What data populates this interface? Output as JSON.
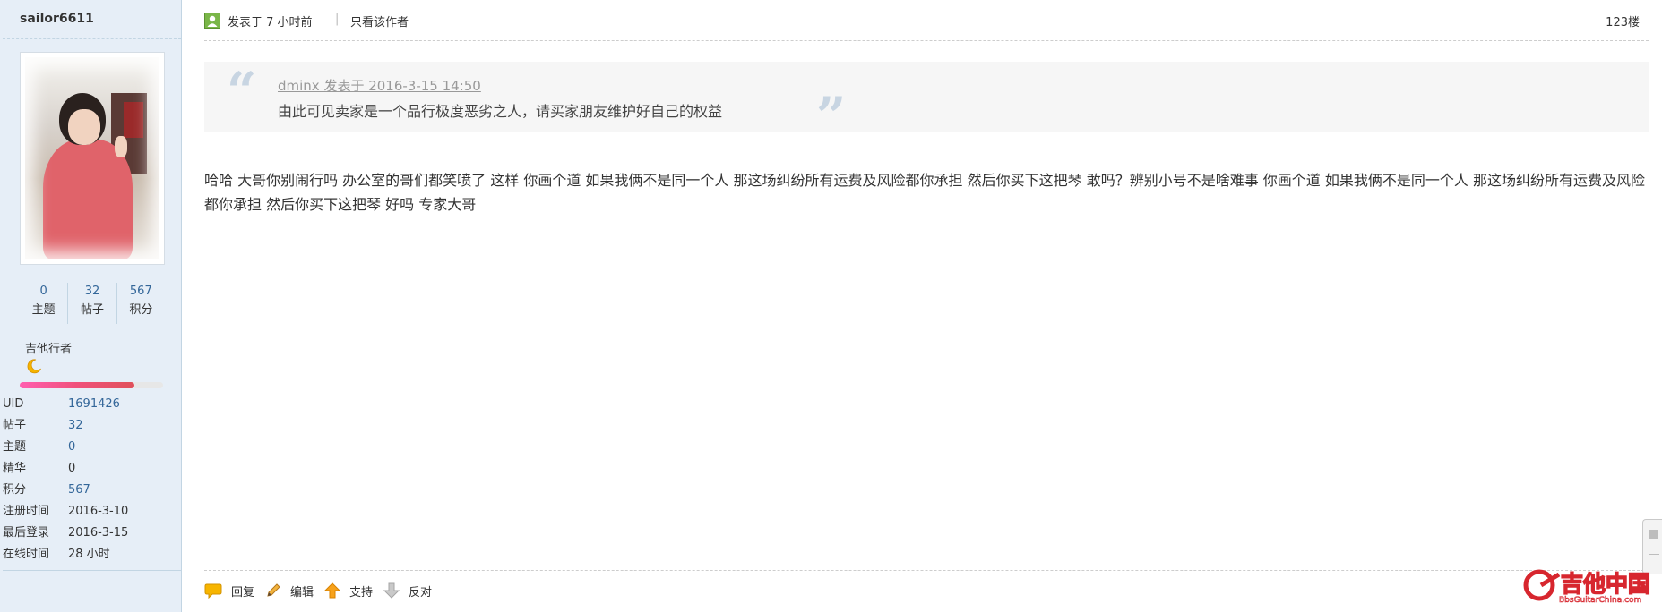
{
  "user": {
    "username": "sailor6611",
    "stats": [
      {
        "value": "0",
        "label": "主题"
      },
      {
        "value": "32",
        "label": "帖子"
      },
      {
        "value": "567",
        "label": "积分"
      }
    ],
    "rank": "吉他行者",
    "rank_icon": "moon-icon",
    "progress_percent": 80,
    "info": [
      {
        "key": "UID",
        "value": "1691426"
      },
      {
        "key": "帖子",
        "value": "32"
      },
      {
        "key": "主题",
        "value": "0"
      },
      {
        "key": "精华",
        "value": "0"
      },
      {
        "key": "积分",
        "value": "567"
      },
      {
        "key": "注册时间",
        "value": "2016-3-10"
      },
      {
        "key": "最后登录",
        "value": "2016-3-15"
      },
      {
        "key": "在线时间",
        "value": "28 小时"
      }
    ]
  },
  "post": {
    "posted_time": "发表于 7 小时前",
    "separator": "|",
    "only_author": "只看该作者",
    "floor": "123楼",
    "quote": {
      "meta": "dminx 发表于 2016-3-15 14:50",
      "text": "由此可见卖家是一个品行极度恶劣之人，请买家朋友维护好自己的权益"
    },
    "content": "哈哈 大哥你别闹行吗 办公室的哥们都笑喷了 这样 你画个道 如果我俩不是同一个人 那这场纠纷所有运费及风险都你承担 然后你买下这把琴 敢吗？辨别小号不是啥难事 你画个道 如果我俩不是同一个人 那这场纠纷所有运费及风险都你承担 然后你买下这把琴 好吗 专家大哥",
    "actions": [
      {
        "label": "回复",
        "icon": "reply-icon"
      },
      {
        "label": "编辑",
        "icon": "edit-icon"
      },
      {
        "label": "支持",
        "icon": "support-icon"
      },
      {
        "label": "反对",
        "icon": "oppose-icon"
      }
    ]
  },
  "watermark": {
    "name": "吉他中国",
    "url": "BbsGuitarChina.com"
  },
  "colors": {
    "sidebar_bg": "#e6eef7",
    "link": "#336699",
    "quote_bg": "#f6f6f6",
    "progress": "#f0507a",
    "watermark_red": "#d7262e"
  }
}
